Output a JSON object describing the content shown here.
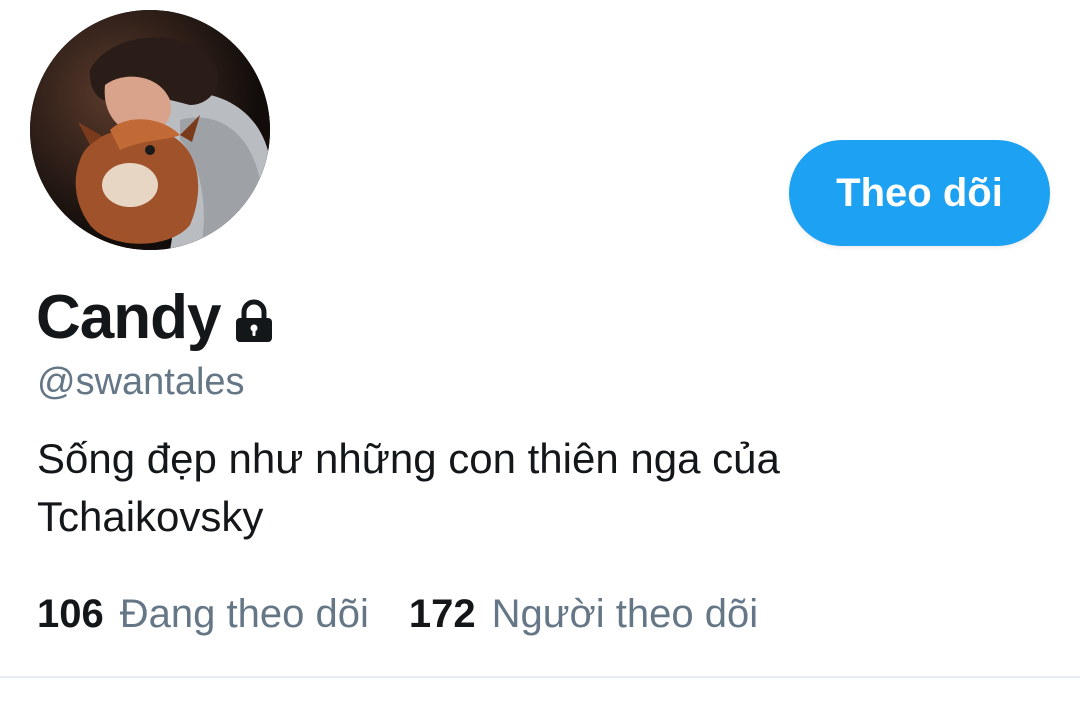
{
  "profile": {
    "display_name": "Candy",
    "handle": "@swantales",
    "bio_line1": "Sống đẹp như những con thiên nga của",
    "bio_line2": "Tchaikovsky",
    "protected_icon": "lock-icon",
    "avatar_icon": "avatar"
  },
  "actions": {
    "follow_label": "Theo dõi"
  },
  "stats": {
    "following_count": "106",
    "following_label": "Đang theo dõi",
    "followers_count": "172",
    "followers_label": "Người theo dõi"
  },
  "colors": {
    "accent": "#1da1f2",
    "primary_text": "#14171a",
    "secondary_text": "#657786",
    "divider": "#e6ecf0"
  }
}
